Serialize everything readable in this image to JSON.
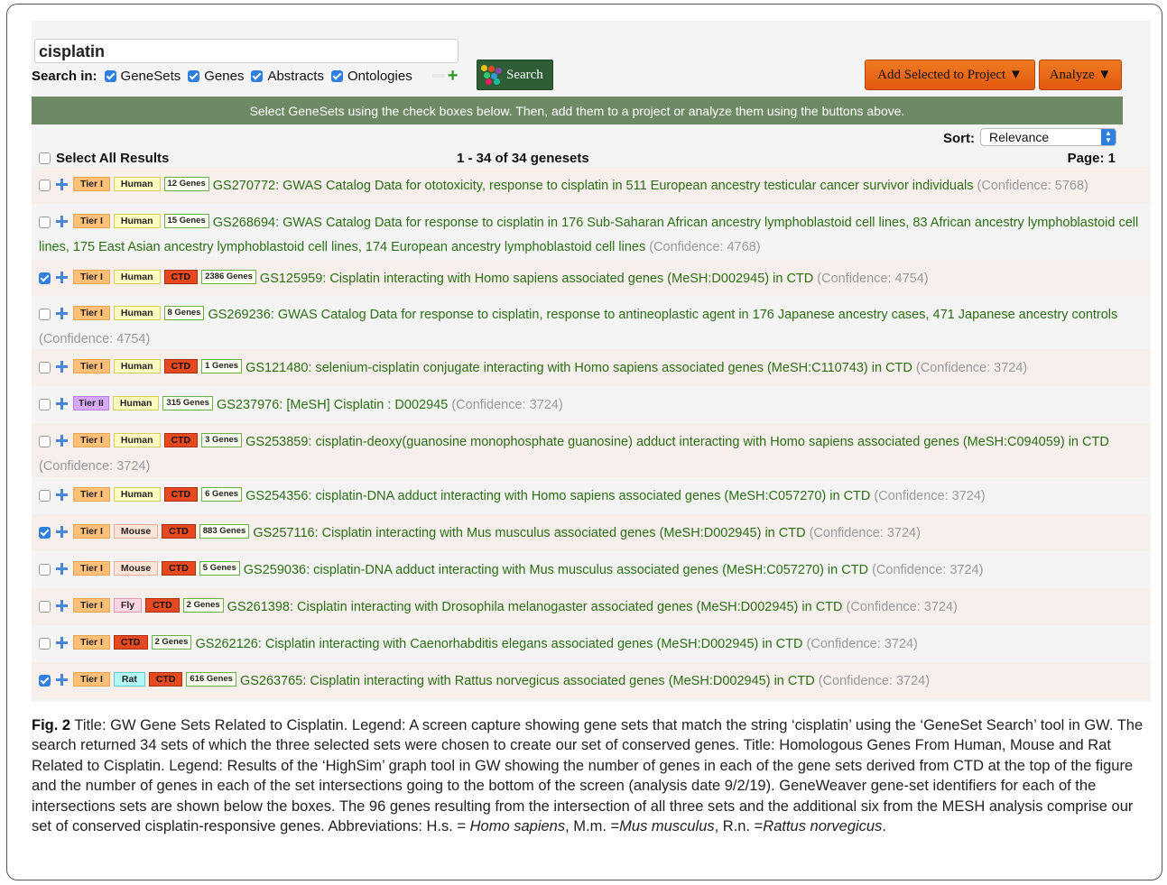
{
  "search": {
    "query": "cisplatin",
    "search_in_label": "Search in:",
    "options": [
      {
        "label": "GeneSets",
        "checked": true
      },
      {
        "label": "Genes",
        "checked": true
      },
      {
        "label": "Abstracts",
        "checked": true
      },
      {
        "label": "Ontologies",
        "checked": true
      }
    ],
    "button_label": "Search"
  },
  "toolbar": {
    "add_label": "Add Selected to Project ▼",
    "analyze_label": "Analyze ▼"
  },
  "banner": {
    "text": "Select GeneSets using the check boxes below. Then, add them to a project or analyze them using the buttons above."
  },
  "sort": {
    "label": "Sort:",
    "value": "Relevance"
  },
  "results_header": {
    "select_all": "Select All Results",
    "count": "1 - 34 of 34 genesets",
    "page": "Page: 1"
  },
  "results": [
    {
      "checked": false,
      "tier": "Tier I",
      "species": "Human",
      "ctd": "",
      "genes": "12 Genes",
      "title": "GS270772: GWAS Catalog Data for ototoxicity, response to cisplatin in 511 European ancestry testicular cancer survivor individuals",
      "confidence": "(Confidence: 5768)"
    },
    {
      "checked": false,
      "tier": "Tier I",
      "species": "Human",
      "ctd": "",
      "genes": "15 Genes",
      "title": "GS268694: GWAS Catalog Data for response to cisplatin in 176 Sub-Saharan African ancestry lymphoblastoid cell lines, 83 African ancestry lymphoblastoid cell lines, 175 East Asian ancestry lymphoblastoid cell lines, 174 European ancestry lymphoblastoid cell lines",
      "confidence": "(Confidence: 4768)"
    },
    {
      "checked": true,
      "tier": "Tier I",
      "species": "Human",
      "ctd": "CTD",
      "genes": "2386 Genes",
      "title": "GS125959: Cisplatin interacting with Homo sapiens associated genes (MeSH:D002945) in CTD",
      "confidence": "(Confidence: 4754)"
    },
    {
      "checked": false,
      "tier": "Tier I",
      "species": "Human",
      "ctd": "",
      "genes": "8 Genes",
      "title": "GS269236: GWAS Catalog Data for response to cisplatin, response to antineoplastic agent in 176 Japanese ancestry cases, 471 Japanese ancestry controls",
      "confidence": "(Confidence: 4754)"
    },
    {
      "checked": false,
      "tier": "Tier I",
      "species": "Human",
      "ctd": "CTD",
      "genes": "1 Genes",
      "title": "GS121480: selenium-cisplatin conjugate interacting with Homo sapiens associated genes (MeSH:C110743) in CTD",
      "confidence": "(Confidence: 3724)"
    },
    {
      "checked": false,
      "tier": "Tier II",
      "species": "Human",
      "ctd": "",
      "genes": "315 Genes",
      "title": "GS237976: [MeSH] Cisplatin : D002945",
      "confidence": "(Confidence: 3724)"
    },
    {
      "checked": false,
      "tier": "Tier I",
      "species": "Human",
      "ctd": "CTD",
      "genes": "3 Genes",
      "title": "GS253859: cisplatin-deoxy(guanosine monophosphate guanosine) adduct interacting with Homo sapiens associated genes (MeSH:C094059) in CTD",
      "confidence": "(Confidence: 3724)"
    },
    {
      "checked": false,
      "tier": "Tier I",
      "species": "Human",
      "ctd": "CTD",
      "genes": "6 Genes",
      "title": "GS254356: cisplatin-DNA adduct interacting with Homo sapiens associated genes (MeSH:C057270) in CTD",
      "confidence": "(Confidence: 3724)"
    },
    {
      "checked": true,
      "tier": "Tier I",
      "species": "Mouse",
      "ctd": "CTD",
      "genes": "883 Genes",
      "title": "GS257116: Cisplatin interacting with Mus musculus associated genes (MeSH:D002945) in CTD",
      "confidence": "(Confidence: 3724)"
    },
    {
      "checked": false,
      "tier": "Tier I",
      "species": "Mouse",
      "ctd": "CTD",
      "genes": "5 Genes",
      "title": "GS259036: cisplatin-DNA adduct interacting with Mus musculus associated genes (MeSH:C057270) in CTD",
      "confidence": "(Confidence: 3724)"
    },
    {
      "checked": false,
      "tier": "Tier I",
      "species": "Fly",
      "ctd": "CTD",
      "genes": "2 Genes",
      "title": "GS261398: Cisplatin interacting with Drosophila melanogaster associated genes (MeSH:D002945) in CTD",
      "confidence": "(Confidence: 3724)"
    },
    {
      "checked": false,
      "tier": "Tier I",
      "species": "",
      "ctd": "CTD",
      "genes": "2 Genes",
      "title": "GS262126: Cisplatin interacting with Caenorhabditis elegans associated genes (MeSH:D002945) in CTD",
      "confidence": "(Confidence: 3724)"
    },
    {
      "checked": true,
      "tier": "Tier I",
      "species": "Rat",
      "ctd": "CTD",
      "genes": "616 Genes",
      "title": "GS263765: Cisplatin interacting with Rattus norvegicus associated genes (MeSH:D002945) in CTD",
      "confidence": "(Confidence: 3724)"
    }
  ],
  "caption": {
    "fig_label": "Fig. 2",
    "body": " Title: GW Gene Sets Related to Cisplatin. Legend: A screen capture showing gene sets that match the string ‘cisplatin’ using the ‘GeneSet Search’ tool in GW. The search returned 34 sets of which the three selected sets were chosen to create our set of conserved genes. Title: Homologous Genes From Human, Mouse and Rat Related to Cisplatin. Legend: Results of the ‘HighSim’ graph tool in GW showing the number of genes in each of the gene sets derived from CTD at the top of the figure and the number of genes in each of the set intersections going to the bottom of the screen (analysis date 9/2/19). GeneWeaver gene-set identifiers for each of the intersections sets are shown below the boxes. The 96 genes resulting from the intersection of all three sets and the additional six from the MESH analysis comprise our set of conserved cisplatin-responsive genes. Abbreviations: H.s. = ",
    "hs": "Homo sapiens",
    "mid1": ", M.m. =",
    "mm": "Mus musculus",
    "mid2": ", R.n. =",
    "rn": "Rattus norvegicus",
    "end": "."
  },
  "colors": {
    "banner": "#6e8a64",
    "title_green": "#2b6e14",
    "button_orange": "#e35a10",
    "search_btn": "#2e5e36",
    "checkbox_blue": "#2f7fe0"
  }
}
